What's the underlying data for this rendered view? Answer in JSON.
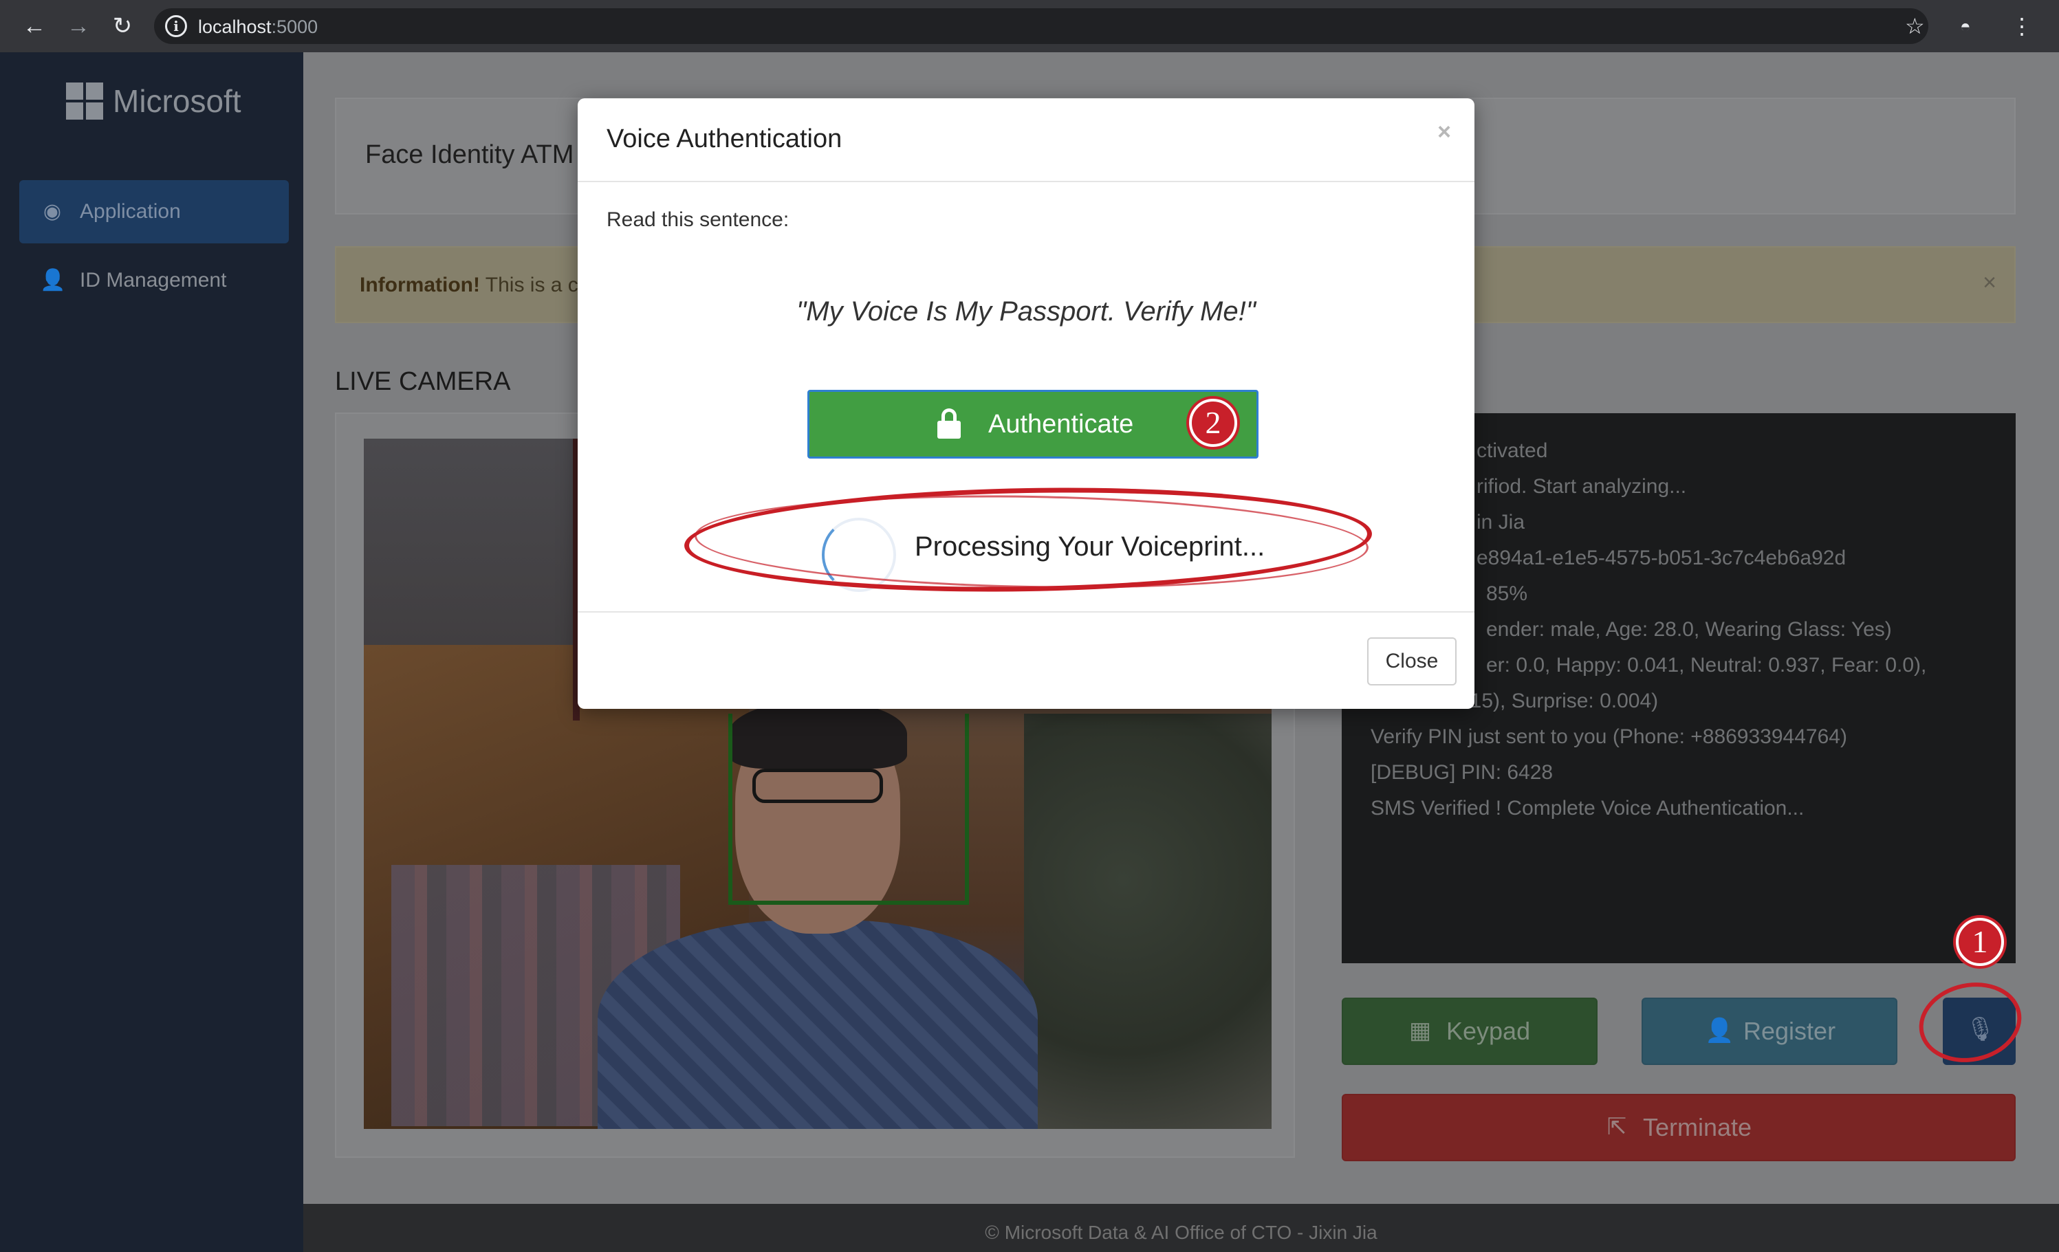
{
  "browser": {
    "url_host": "localhost",
    "url_port": ":5000",
    "icons": [
      "back-icon",
      "forward-icon",
      "reload-icon",
      "info-icon",
      "star-icon",
      "incognito-icon",
      "menu-icon"
    ]
  },
  "sidebar": {
    "brand": "Microsoft",
    "items": [
      {
        "label": "Application",
        "icon": "eye-icon",
        "active": true
      },
      {
        "label": "ID Management",
        "icon": "user-icon",
        "active": false
      }
    ]
  },
  "main": {
    "panel_title": "Face Identity ATM",
    "info_alert": {
      "bold": "Information!",
      "text": "This is a c"
    },
    "live_camera_label": "LIVE CAMERA",
    "terminal_lines": [
      "ctivated",
      "rifiod. Start analyzing...",
      "in Jia",
      "e894a1-e1e5-4575-b051-3c7c4eb6a92d",
      "85%",
      "ender: male, Age: 28.0, Wearing Glass: Yes)",
      "er: 0.0, Happy: 0.041, Neutral: 0.937, Fear: 0.0),",
      "015), Surprise: 0.004)",
      "Verify PIN just sent to you (Phone: +886933944764)",
      "[DEBUG] PIN: 6428",
      "SMS Verified ! Complete Voice Authentication..."
    ],
    "buttons": {
      "keypad": "Keypad",
      "register": "Register",
      "terminate": "Terminate"
    }
  },
  "footer": {
    "text": "© Microsoft Data & AI Office of CTO - Jixin Jia"
  },
  "modal": {
    "title": "Voice Authentication",
    "close_x": "×",
    "read_label": "Read this sentence:",
    "sentence": "\"My Voice Is My Passport. Verify Me!\"",
    "authenticate_label": "Authenticate",
    "processing_text": "Processing Your Voiceprint...",
    "close_label": "Close"
  },
  "annotations": {
    "marker_1": "1",
    "marker_2": "2",
    "color": "#c8202a"
  },
  "colors": {
    "success": "#419e42",
    "danger": "#7a2524",
    "info": "#2e5566",
    "primary": "#1c3454"
  }
}
